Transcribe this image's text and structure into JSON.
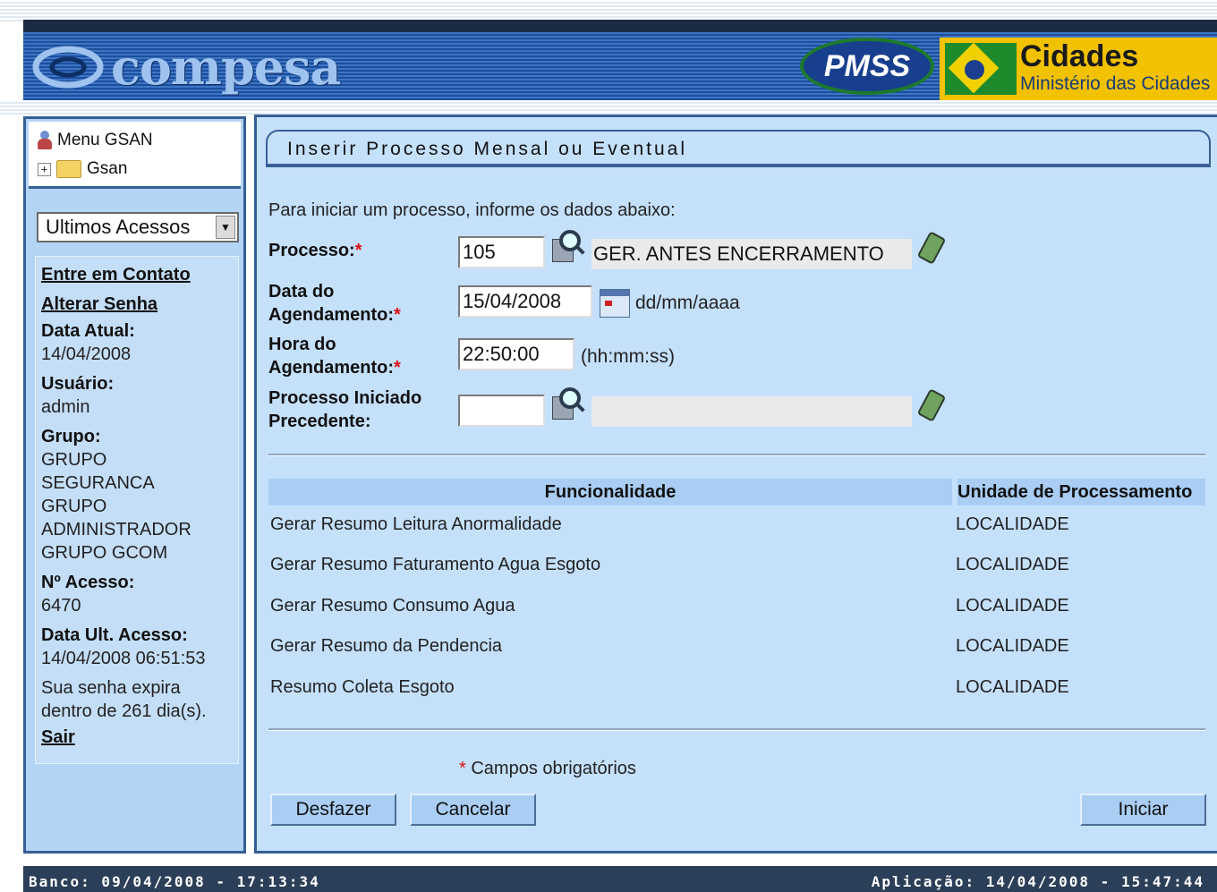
{
  "header": {
    "logo_text": "compesa",
    "pmss_text": "PMSS",
    "cidades_title": "Cidades",
    "cidades_subtitle": "Ministério das Cidades"
  },
  "sidebar": {
    "menu_title": "Menu GSAN",
    "tree_item": "Gsan",
    "recent_select": "Ultimos Acessos",
    "contact_link": "Entre em Contato",
    "change_password_link": "Alterar Senha",
    "current_date_label": "Data Atual:",
    "current_date_value": "14/04/2008",
    "user_label": "Usuário:",
    "user_value": "admin",
    "group_label": "Grupo:",
    "groups": [
      "GRUPO",
      "SEGURANCA",
      "GRUPO",
      "ADMINISTRADOR",
      "GRUPO GCOM"
    ],
    "access_no_label": "Nº Acesso:",
    "access_no_value": "6470",
    "last_access_label": "Data Ult. Acesso:",
    "last_access_value": "14/04/2008 06:51:53",
    "password_expiry_line1": "Sua senha expira",
    "password_expiry_line2": "dentro de 261 dia(s).",
    "logout_link": "Sair"
  },
  "form": {
    "title": "Inserir Processo Mensal ou Eventual",
    "intro": "Para iniciar um processo, informe os dados abaixo:",
    "process_label": "Processo:",
    "process_value": "105",
    "process_description": "GER. ANTES ENCERRAMENTO",
    "date_label_line1": "Data do",
    "date_label_line2": "Agendamento:",
    "date_value": "15/04/2008",
    "date_hint": "dd/mm/aaaa",
    "time_label_line1": "Hora do",
    "time_label_line2": "Agendamento:",
    "time_value": "22:50:00",
    "time_hint": "(hh:mm:ss)",
    "preceding_label_line1": "Processo Iniciado",
    "preceding_label_line2": "Precedente:",
    "preceding_value": "",
    "preceding_description": "",
    "required_mark": "*",
    "required_note": "Campos obrigatórios"
  },
  "table": {
    "headers": [
      "Funcionalidade",
      "Unidade de Processamento"
    ],
    "rows": [
      [
        "Gerar Resumo Leitura Anormalidade",
        "LOCALIDADE"
      ],
      [
        "Gerar Resumo Faturamento Agua Esgoto",
        "LOCALIDADE"
      ],
      [
        "Gerar Resumo Consumo Agua",
        "LOCALIDADE"
      ],
      [
        "Gerar Resumo da Pendencia",
        "LOCALIDADE"
      ],
      [
        "Resumo Coleta Esgoto",
        "LOCALIDADE"
      ]
    ]
  },
  "buttons": {
    "undo": "Desfazer",
    "cancel": "Cancelar",
    "start": "Iniciar"
  },
  "footer": {
    "database": "Banco: 09/04/2008 - 17:13:34",
    "application": "Aplicação: 14/04/2008 - 15:47:44"
  }
}
